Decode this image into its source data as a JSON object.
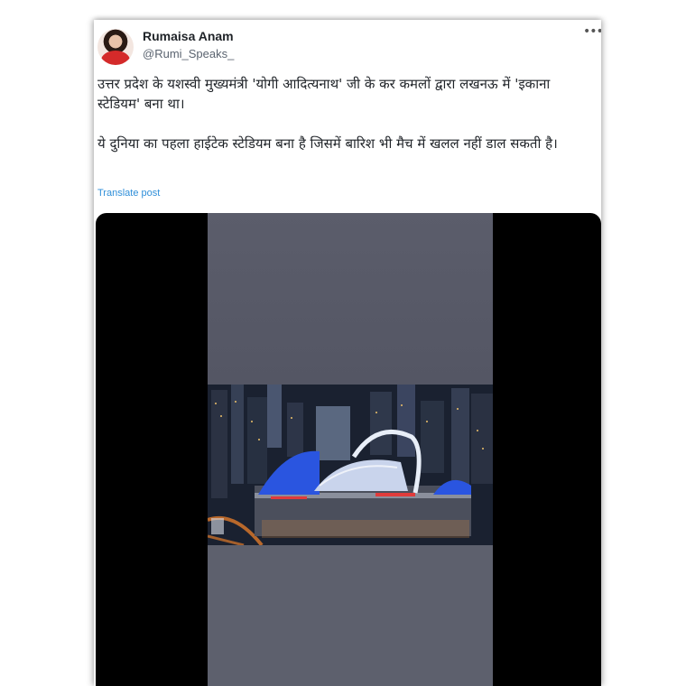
{
  "tweet": {
    "author_name": "Rumaisa Anam",
    "handle": "@Rumi_Speaks_",
    "more_icon": "more-dots-icon",
    "text_paragraph_1": "उत्तर प्रदेश के यशस्वी मुख्यमंत्री 'योगी आदित्यनाथ' जी के कर कमलों द्वारा लखनऊ में 'इकाना स्टेडियम' बना था।",
    "text_paragraph_2": "ये दुनिया का पहला हाईटेक स्टेडियम बना है जिसमें बारिश भी मैच में खलल नहीं डाल सकती है।",
    "translate_label": "Translate post",
    "link_color": "#2f8fd9"
  },
  "video": {
    "progress": 0.5,
    "background": "#000000",
    "frame_color": "#565866",
    "dome_color": "#2a55e0"
  }
}
